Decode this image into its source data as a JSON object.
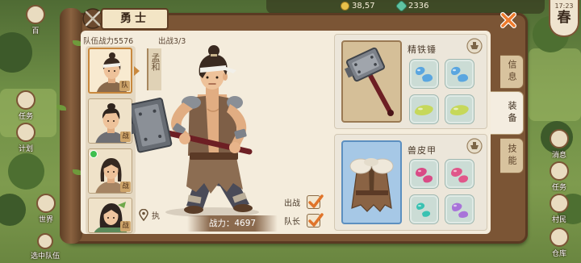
{
  "top_bar": {
    "currency_coins": "38,57",
    "currency_jade": "2336",
    "clock": {
      "time": "17:23",
      "season": "春"
    }
  },
  "left_menu": [
    {
      "label": "百",
      "icon": "book-icon"
    },
    {
      "label": "任务",
      "icon": "scroll-icon"
    },
    {
      "label": "计划",
      "icon": "plan-icon"
    },
    {
      "label": "世界",
      "icon": "globe-icon"
    },
    {
      "label": "选中队伍",
      "icon": "team-icon"
    }
  ],
  "right_menu": [
    {
      "label": "消息",
      "icon": "message-icon"
    },
    {
      "label": "任务",
      "icon": "task-icon"
    },
    {
      "label": "村民",
      "icon": "villager-icon"
    },
    {
      "label": "仓库",
      "icon": "warehouse-icon"
    }
  ],
  "panel": {
    "title": "勇士",
    "team_power": "队伍战力5576",
    "deployed": "出战3/3",
    "roster": [
      {
        "badge": "队",
        "selected": true,
        "new": false
      },
      {
        "badge": "战",
        "selected": false,
        "new": false
      },
      {
        "badge": "战",
        "selected": false,
        "new": true
      },
      {
        "badge": "战",
        "selected": false,
        "new": false
      }
    ],
    "character": {
      "name": "孟和",
      "location": "执",
      "power": "战力：4697"
    },
    "toggles": [
      {
        "label": "出战",
        "checked": true
      },
      {
        "label": "队长",
        "checked": true
      }
    ],
    "equipment": [
      {
        "slot": "weapon",
        "name": "精铁锤",
        "icon": "hammer-icon",
        "gems": [
          {
            "color": "#5aa6e0"
          },
          {
            "color": "#5aa6e0"
          },
          {
            "color": "#c6d85a"
          },
          {
            "color": "#c6d85a"
          }
        ]
      },
      {
        "slot": "armor",
        "name": "兽皮甲",
        "icon": "fur-armor-icon",
        "gems": [
          {
            "color": "#d94b86"
          },
          {
            "color": "#e0568a"
          },
          {
            "color": "#39c2b2"
          },
          {
            "color": "#a873d9"
          }
        ]
      }
    ],
    "tabs": [
      {
        "label": "信息",
        "active": false
      },
      {
        "label": "装备",
        "active": true
      },
      {
        "label": "技能",
        "active": false
      }
    ]
  },
  "colors": {
    "accent": "#e8762d",
    "parchment": "#f4ecdc",
    "frame": "#7b5535"
  }
}
